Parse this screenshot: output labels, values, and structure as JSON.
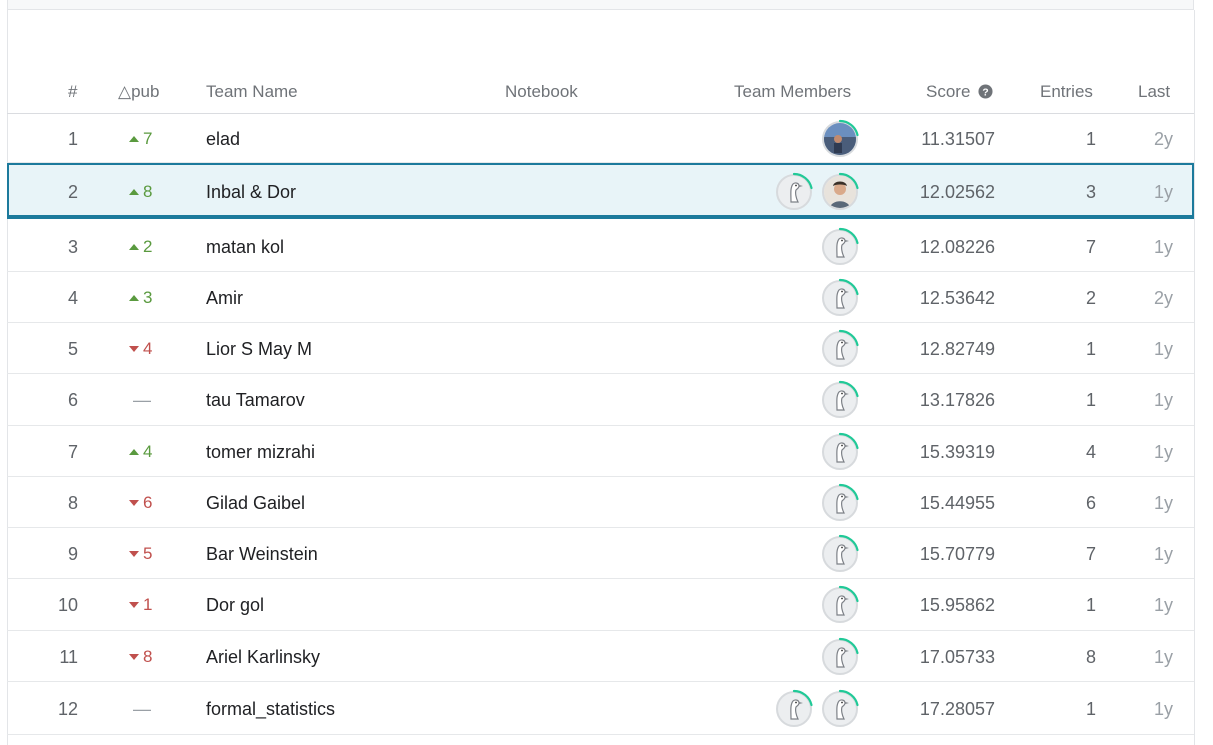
{
  "columns": {
    "rank": "#",
    "delta": "△pub",
    "team": "Team Name",
    "notebook": "Notebook",
    "members": "Team Members",
    "score": "Score",
    "entries": "Entries",
    "last": "Last"
  },
  "help_icon": "question-circle-icon",
  "colors": {
    "up": "#5a9a3f",
    "down": "#c0504d",
    "highlight_border": "#1c7a9c",
    "highlight_bg": "#e8f4f8",
    "ring": "#20c997"
  },
  "rows": [
    {
      "rank": "1",
      "dir": "up",
      "delta": "7",
      "team": "elad",
      "avatars": [
        "photo-landscape"
      ],
      "score": "11.31507",
      "entries": "1",
      "last": "2y"
    },
    {
      "rank": "2",
      "dir": "up",
      "delta": "8",
      "team": "Inbal & Dor",
      "avatars": [
        "default-goose",
        "photo-person"
      ],
      "score": "12.02562",
      "entries": "3",
      "last": "1y",
      "highlighted": true
    },
    {
      "rank": "3",
      "dir": "up",
      "delta": "2",
      "team": "matan kol",
      "avatars": [
        "default-goose"
      ],
      "score": "12.08226",
      "entries": "7",
      "last": "1y"
    },
    {
      "rank": "4",
      "dir": "up",
      "delta": "3",
      "team": "Amir",
      "avatars": [
        "default-goose"
      ],
      "score": "12.53642",
      "entries": "2",
      "last": "2y"
    },
    {
      "rank": "5",
      "dir": "down",
      "delta": "4",
      "team": "Lior S May M",
      "avatars": [
        "default-goose"
      ],
      "score": "12.82749",
      "entries": "1",
      "last": "1y"
    },
    {
      "rank": "6",
      "dir": "none",
      "delta": "—",
      "team": "tau Tamarov",
      "avatars": [
        "default-goose"
      ],
      "score": "13.17826",
      "entries": "1",
      "last": "1y"
    },
    {
      "rank": "7",
      "dir": "up",
      "delta": "4",
      "team": "tomer mizrahi",
      "avatars": [
        "default-goose"
      ],
      "score": "15.39319",
      "entries": "4",
      "last": "1y"
    },
    {
      "rank": "8",
      "dir": "down",
      "delta": "6",
      "team": "Gilad Gaibel",
      "avatars": [
        "default-goose"
      ],
      "score": "15.44955",
      "entries": "6",
      "last": "1y"
    },
    {
      "rank": "9",
      "dir": "down",
      "delta": "5",
      "team": "Bar Weinstein",
      "avatars": [
        "default-goose"
      ],
      "score": "15.70779",
      "entries": "7",
      "last": "1y"
    },
    {
      "rank": "10",
      "dir": "down",
      "delta": "1",
      "team": "Dor gol",
      "avatars": [
        "default-goose"
      ],
      "score": "15.95862",
      "entries": "1",
      "last": "1y"
    },
    {
      "rank": "11",
      "dir": "down",
      "delta": "8",
      "team": "Ariel Karlinsky",
      "avatars": [
        "default-goose"
      ],
      "score": "17.05733",
      "entries": "8",
      "last": "1y"
    },
    {
      "rank": "12",
      "dir": "none",
      "delta": "—",
      "team": "formal_statistics",
      "avatars": [
        "default-goose",
        "default-goose"
      ],
      "score": "17.28057",
      "entries": "1",
      "last": "1y"
    }
  ]
}
